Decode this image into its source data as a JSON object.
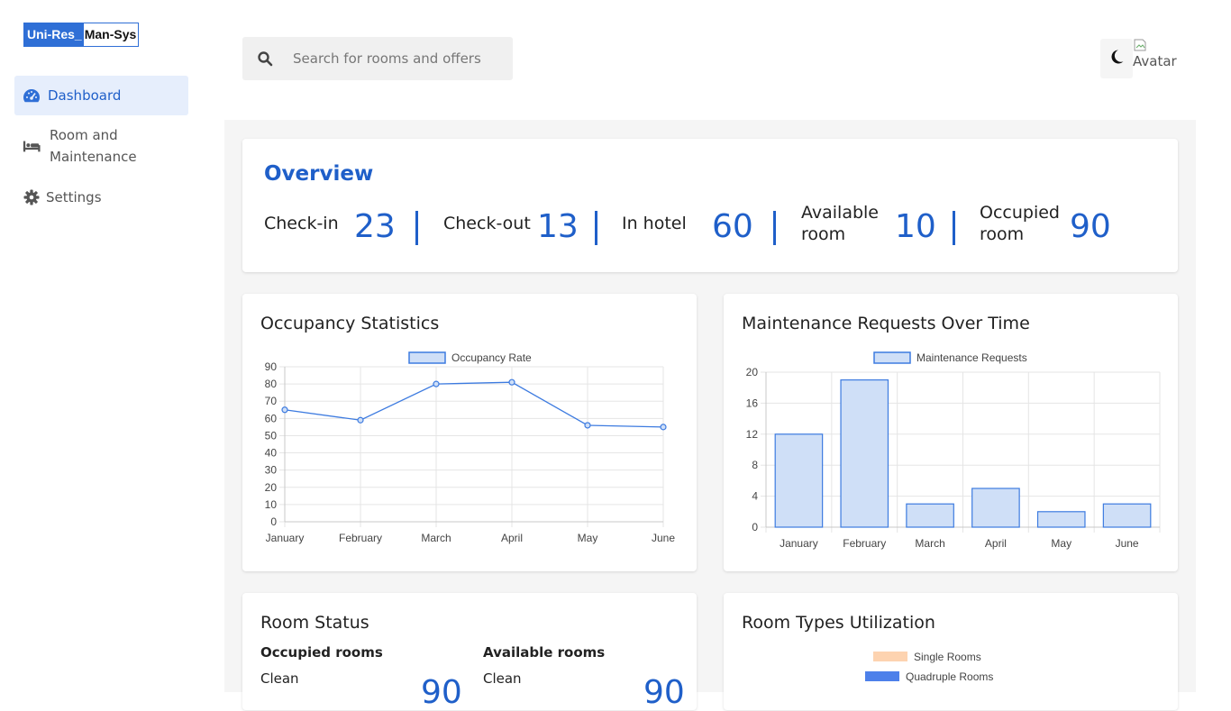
{
  "app": {
    "logo_part1": "Uni-Res_",
    "logo_part2": "Man-Sys"
  },
  "sidebar": {
    "items": [
      {
        "label": "Dashboard",
        "icon": "dashboard-gauge-icon",
        "active": true
      },
      {
        "label": "Room and Maintenance",
        "icon": "bed-icon",
        "active": false
      },
      {
        "label": "Settings",
        "icon": "gear-icon",
        "active": false
      }
    ]
  },
  "header": {
    "search": {
      "placeholder": "Search for rooms and offers",
      "value": "",
      "icon": "search-icon"
    },
    "theme_toggle_icon": "moon-icon",
    "avatar_alt": "Avatar"
  },
  "overview": {
    "title": "Overview",
    "stats": [
      {
        "label": "Check-in",
        "value": "23"
      },
      {
        "label": "Check-out",
        "value": "13"
      },
      {
        "label": "In hotel",
        "value": "60"
      },
      {
        "label_line1": "Available",
        "label_line2": "room",
        "value": "10"
      },
      {
        "label_line1": "Occupied",
        "label_line2": "room",
        "value": "90"
      }
    ]
  },
  "colors": {
    "accent": "#1f5fc9",
    "series_fill": "#cfdff7",
    "series_stroke": "#3d7be0",
    "single_rooms": "#fdd3b0",
    "quadruple_rooms": "#4d80ea"
  },
  "chart_data": [
    {
      "type": "line",
      "title": "Occupancy Statistics",
      "categories": [
        "January",
        "February",
        "March",
        "April",
        "May",
        "June"
      ],
      "series": [
        {
          "name": "Occupancy Rate",
          "values": [
            65,
            59,
            80,
            81,
            56,
            55
          ]
        }
      ],
      "yticks": [
        0,
        10,
        20,
        30,
        40,
        50,
        60,
        70,
        80,
        90
      ],
      "ylim": [
        0,
        90
      ],
      "grid": true,
      "legend": "top-center"
    },
    {
      "type": "bar",
      "title": "Maintenance Requests Over Time",
      "categories": [
        "January",
        "February",
        "March",
        "April",
        "May",
        "June"
      ],
      "series": [
        {
          "name": "Maintenance Requests",
          "values": [
            12,
            19,
            3,
            5,
            2,
            3
          ]
        }
      ],
      "yticks": [
        0,
        4,
        8,
        12,
        16,
        20
      ],
      "ylim": [
        0,
        20
      ],
      "grid": true,
      "legend": "top-center"
    },
    {
      "type": "pie",
      "title": "Room Types Utilization",
      "series": [
        {
          "name": "Single Rooms"
        },
        {
          "name": "Quadruple Rooms"
        }
      ],
      "legend": "top-center"
    }
  ],
  "room_status": {
    "title": "Room Status",
    "occupied": {
      "heading": "Occupied rooms",
      "sub": "Clean",
      "value": "90"
    },
    "available": {
      "heading": "Available rooms",
      "sub": "Clean",
      "value": "90"
    }
  }
}
